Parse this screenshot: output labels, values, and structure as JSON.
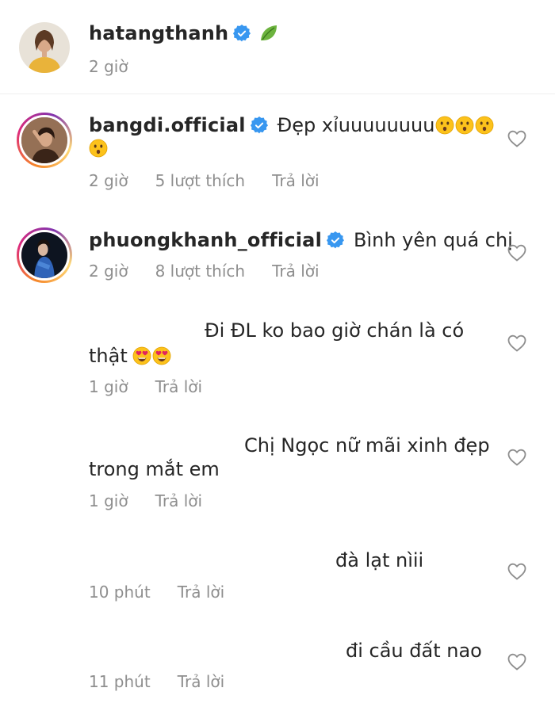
{
  "caption": {
    "username": "hatangthanh",
    "time": "2 giờ",
    "emoji_icon": "leaf-icon"
  },
  "comments": [
    {
      "username": "bangdi.official",
      "verified": true,
      "text_line1": "Đẹp xỉuuuuuuuu",
      "emoji_icon": "astonished-face-icon",
      "time": "2 giờ",
      "likes": "5 lượt thích",
      "reply": "Trả lời"
    },
    {
      "username": "phuongkhanh_official",
      "verified": true,
      "text_line1": "Bình yên quá chị",
      "time": "2 giờ",
      "likes": "8 lượt thích",
      "reply": "Trả lời"
    },
    {
      "text_line1": "Đi ĐL ko bao giờ chán là có",
      "text_line2": "thật",
      "emoji_icon": "heart-eyes-face-icon",
      "time": "1 giờ",
      "reply": "Trả lời"
    },
    {
      "text_line1": "Chị Ngọc nữ mãi xinh đẹp",
      "text_line2": "trong mắt em",
      "time": "1 giờ",
      "reply": "Trả lời"
    },
    {
      "text_line1": "đà lạt nìii",
      "time": "10 phút",
      "reply": "Trả lời"
    },
    {
      "text_line1": "đi cầu đất nao",
      "time": "11 phút",
      "reply": "Trả lời"
    }
  ],
  "colors": {
    "text": "#262626",
    "secondary": "#8e8e8e",
    "verified": "#3897f0"
  }
}
